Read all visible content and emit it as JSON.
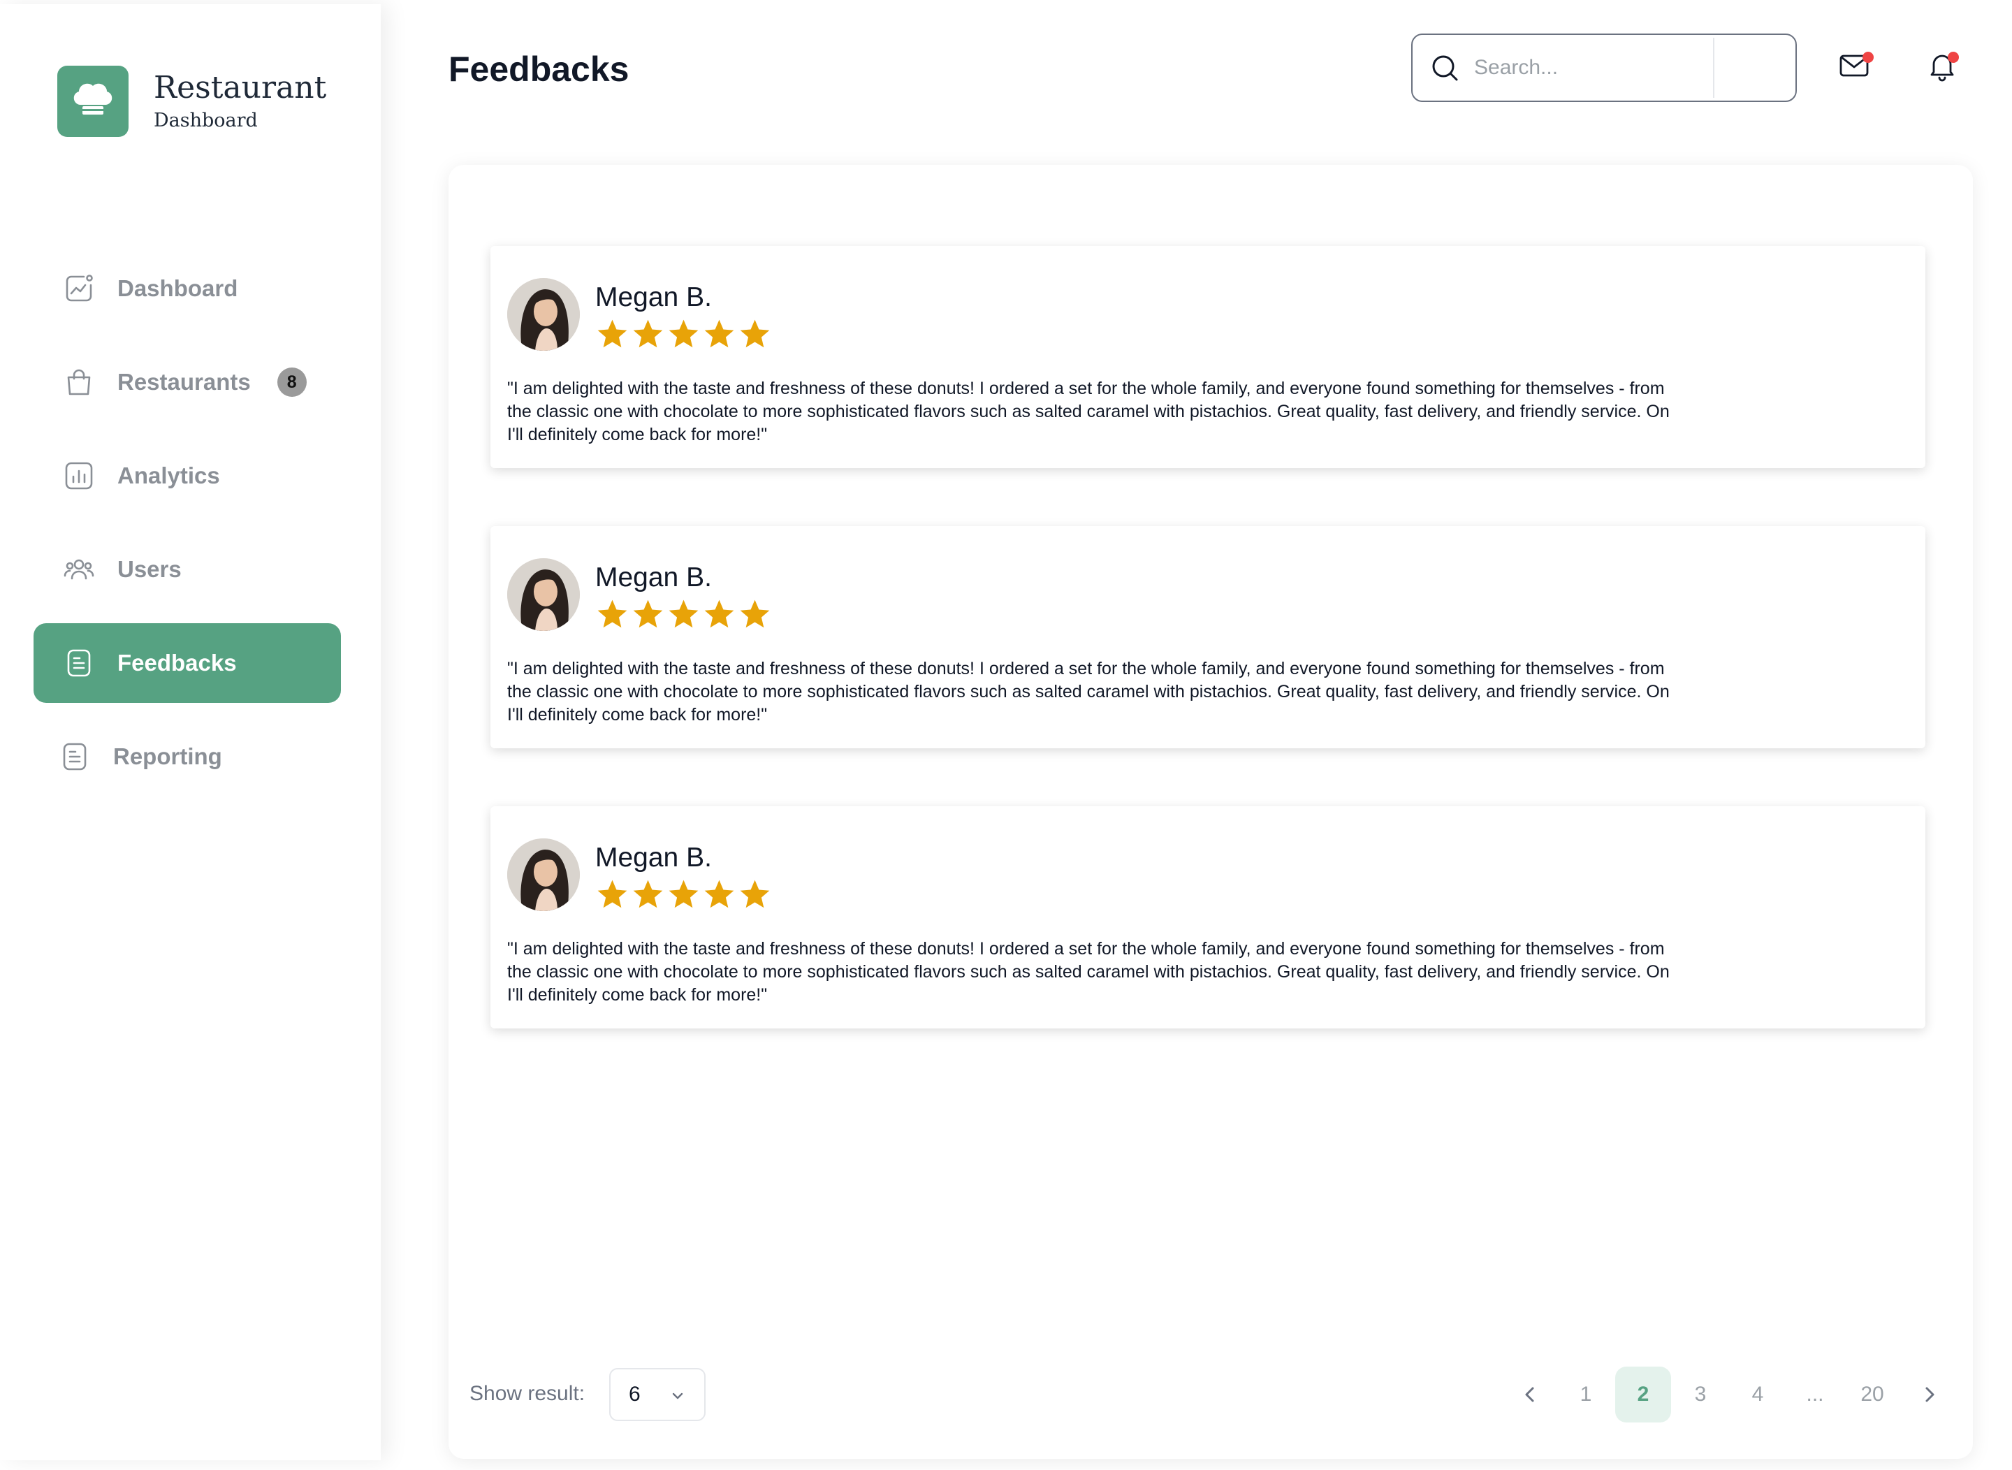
{
  "brand": {
    "title": "Restaurant",
    "subtitle": "Dashboard",
    "accent_color": "#56a282"
  },
  "sidebar": {
    "items": [
      {
        "label": "Dashboard",
        "icon": "chart-icon",
        "active": false
      },
      {
        "label": "Restaurants",
        "icon": "bag-icon",
        "badge": "8",
        "active": false
      },
      {
        "label": "Analytics",
        "icon": "bar-chart-icon",
        "active": false
      },
      {
        "label": "Users",
        "icon": "users-icon",
        "active": false
      },
      {
        "label": "Feedbacks",
        "icon": "document-icon",
        "active": true
      },
      {
        "label": "Reporting",
        "icon": "document-icon",
        "active": false
      }
    ]
  },
  "header": {
    "title": "Feedbacks",
    "search_placeholder": "Search...",
    "notification_dot_color": "#ef4444"
  },
  "feedbacks": [
    {
      "name": "Megan B.",
      "rating": 5,
      "text": "\"I am delighted with the taste and freshness of these donuts! I ordered a set for the whole family, and everyone found something for themselves - from the classic one with chocolate to more sophisticated flavors such as salted caramel with pistachios. Great quality, fast delivery, and friendly service. On I'll definitely come back for more!\""
    },
    {
      "name": "Megan B.",
      "rating": 5,
      "text": "\"I am delighted with the taste and freshness of these donuts! I ordered a set for the whole family, and everyone found something for themselves - from the classic one with chocolate to more sophisticated flavors such as salted caramel with pistachios. Great quality, fast delivery, and friendly service. On I'll definitely come back for more!\""
    },
    {
      "name": "Megan B.",
      "rating": 5,
      "text": "\"I am delighted with the taste and freshness of these donuts! I ordered a set for the whole family, and everyone found something for themselves - from the classic one with chocolate to more sophisticated flavors such as salted caramel with pistachios. Great quality, fast delivery, and friendly service. On I'll definitely come back for more!\""
    }
  ],
  "star_color": "#e8a308",
  "footer": {
    "show_result_label": "Show result:",
    "show_result_value": "6",
    "pages": [
      "1",
      "2",
      "3",
      "4",
      "...",
      "20"
    ],
    "current_page": "2"
  }
}
